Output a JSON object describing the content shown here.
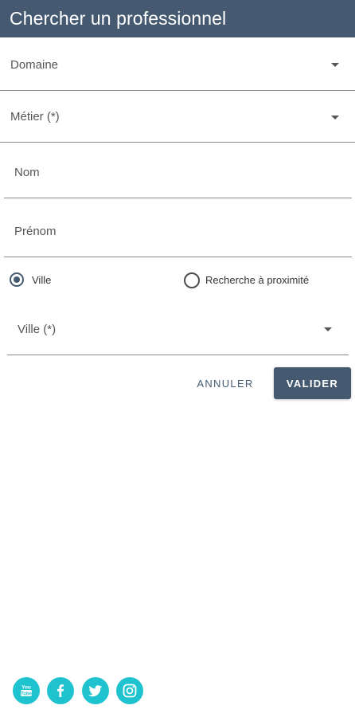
{
  "header": {
    "title": "Chercher un professionnel"
  },
  "form": {
    "domaine": {
      "placeholder": "Domaine"
    },
    "metier": {
      "placeholder": "Métier (*)"
    },
    "nom": {
      "placeholder": "Nom"
    },
    "prenom": {
      "placeholder": "Prénom"
    },
    "location_mode": {
      "options": [
        {
          "label": "Ville",
          "selected": true
        },
        {
          "label": "Recherche à proximité",
          "selected": false
        }
      ]
    },
    "ville": {
      "placeholder": "Ville (*)"
    }
  },
  "actions": {
    "cancel_label": "ANNULER",
    "submit_label": "VALIDER"
  },
  "footer": {
    "social": [
      {
        "icon": "youtube-icon"
      },
      {
        "icon": "facebook-icon"
      },
      {
        "icon": "twitter-icon"
      },
      {
        "icon": "instagram-icon"
      }
    ]
  },
  "colors": {
    "primary": "#455a70",
    "social": "#1ec3cf"
  }
}
